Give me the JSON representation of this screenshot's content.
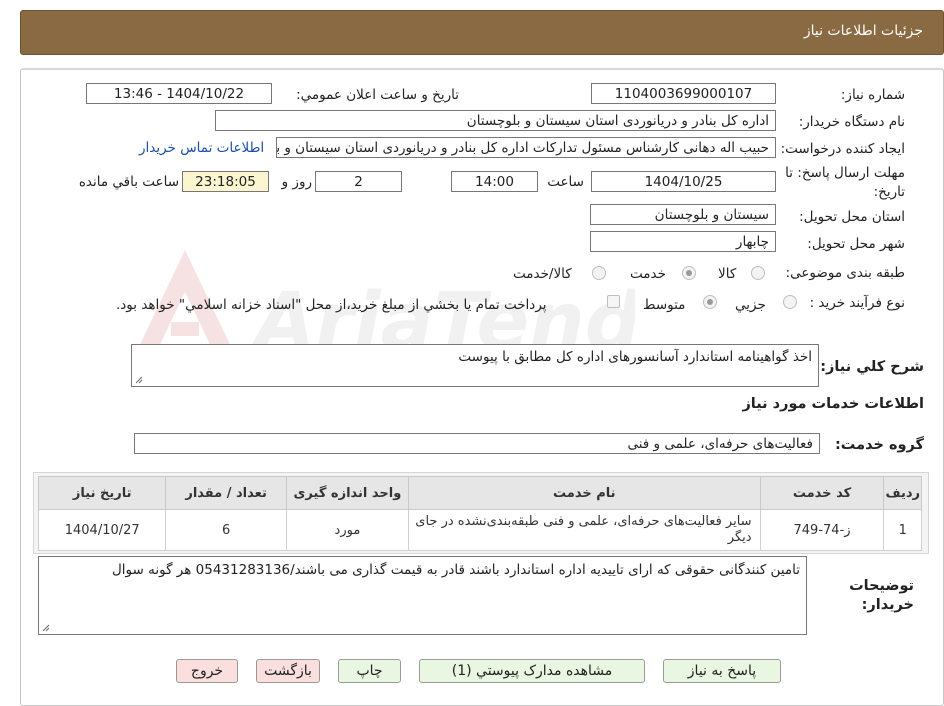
{
  "header": {
    "title": "جزئیات اطلاعات نیاز"
  },
  "form": {
    "need_number_label": "شماره نیاز:",
    "need_number_value": "1104003699000107",
    "announce_label": "تاریخ و ساعت اعلان عمومي:",
    "announce_value": "1404/10/22 - 13:46",
    "buyer_org_label": "نام دستگاه خريدار:",
    "buyer_org_value": "اداره کل بنادر و دریانوردی استان سیستان و بلوچستان",
    "requester_label": "ايجاد کننده درخواست:",
    "requester_value": "حبیب اله دهانی کارشناس مسئول تدارکات اداره کل بنادر و دریانوردی استان سیستان و بلوچستان",
    "contact_link": "اطلاعات تماس خريدار",
    "deadline_label_line1": "مهلت ارسال پاسخ: تا",
    "deadline_label_line2": "تاريخ:",
    "deadline_date": "1404/10/25",
    "time_label": "ساعت",
    "deadline_time": "14:00",
    "days_value": "2",
    "days_label": "روز و",
    "remaining_value": "23:18:05",
    "remaining_label": "ساعت باقي مانده",
    "province_label": "استان محل تحويل:",
    "province_value": "سیستان و بلوچستان",
    "city_label": "شهر محل تحويل:",
    "city_value": "چابهار",
    "category_label": "طبقه بندی موضوعی:",
    "category_options": [
      "کالا",
      "خدمت",
      "کالا/خدمت"
    ],
    "category_selected": "خدمت",
    "process_label": "نوع فرآيند خريد :",
    "process_options": [
      "جزيي",
      "متوسط"
    ],
    "process_selected": "متوسط",
    "payment_note": "پرداخت تمام يا بخشي از مبلغ خريد،از محل \"اسناد خزانه اسلامي\" خواهد بود.",
    "description_label": "شرح کلي نياز:",
    "description_value": "اخذ گواهینامه استاندارد آسانسورهای اداره کل مطابق با پیوست",
    "services_heading": "اطلاعات خدمات مورد نياز",
    "service_group_label": "گروه خدمت:",
    "service_group_value": "فعالیت‌های حرفه‌ای، علمی و فنی",
    "buyer_notes_label_line1": "توضيحات",
    "buyer_notes_label_line2": "خريدار:",
    "buyer_notes_value": "تامین کنندگانی حقوقی که ارای تاییدیه اداره  استاندارد باشند قادر به قیمت گذاری می باشند/05431283136 هر گونه سوال"
  },
  "table": {
    "headers": [
      "رديف",
      "کد خدمت",
      "نام خدمت",
      "واحد اندازه گيری",
      "تعداد / مقدار",
      "تاريخ نياز"
    ],
    "rows": [
      {
        "row": "1",
        "code": "ز-74-749",
        "name": "سایر فعالیت‌های حرفه‌ای، علمی و فنی طبقه‌بندی‌نشده در جای دیگر",
        "unit": "مورد",
        "qty": "6",
        "date": "1404/10/27"
      }
    ]
  },
  "buttons": {
    "reply": "پاسخ به نياز",
    "attachments": "مشاهده مدارک پيوستي (1)",
    "print": "چاپ",
    "back": "بازگشت",
    "exit": "خروج"
  },
  "watermark": {
    "text": "AriaTender.neT"
  },
  "colors": {
    "header_bg": "#8a6a42",
    "link": "#1a4fa8",
    "button_green": "#e9f6e2",
    "button_pink": "#fbdede",
    "remaining_bg": "#fbf6d0"
  }
}
